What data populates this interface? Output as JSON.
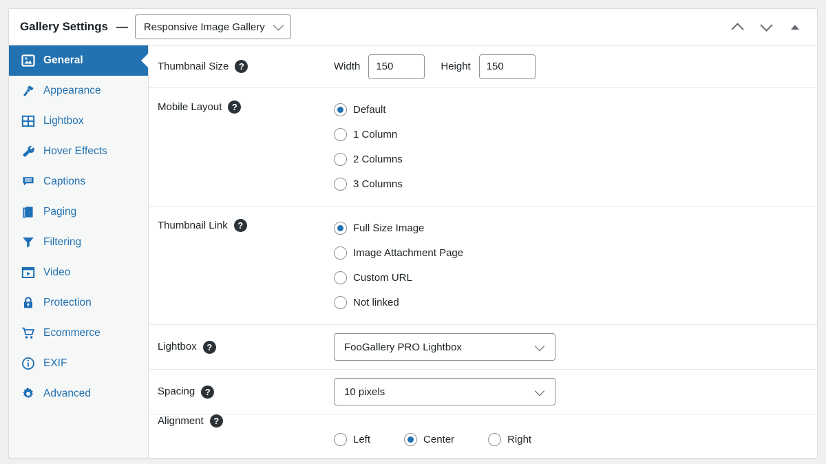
{
  "header": {
    "title": "Gallery Settings",
    "dash": "—",
    "gallery_template": "Responsive Image Gallery",
    "actions": [
      "chevron-up",
      "chevron-down",
      "triangle-up"
    ]
  },
  "sidebar": {
    "items": [
      {
        "label": "General",
        "icon": "image-icon",
        "active": true
      },
      {
        "label": "Appearance",
        "icon": "brush-icon",
        "active": false
      },
      {
        "label": "Lightbox",
        "icon": "grid-icon",
        "active": false
      },
      {
        "label": "Hover Effects",
        "icon": "wrench-icon",
        "active": false
      },
      {
        "label": "Captions",
        "icon": "comment-icon",
        "active": false
      },
      {
        "label": "Paging",
        "icon": "book-icon",
        "active": false
      },
      {
        "label": "Filtering",
        "icon": "funnel-icon",
        "active": false
      },
      {
        "label": "Video",
        "icon": "video-icon",
        "active": false
      },
      {
        "label": "Protection",
        "icon": "lock-icon",
        "active": false
      },
      {
        "label": "Ecommerce",
        "icon": "cart-icon",
        "active": false
      },
      {
        "label": "EXIF",
        "icon": "info-icon",
        "active": false
      },
      {
        "label": "Advanced",
        "icon": "gear-icon",
        "active": false
      }
    ]
  },
  "help_glyph": "?",
  "settings": {
    "thumbnail_size": {
      "label": "Thumbnail Size",
      "width_label": "Width",
      "width_value": "150",
      "height_label": "Height",
      "height_value": "150"
    },
    "mobile_layout": {
      "label": "Mobile Layout",
      "options": [
        {
          "label": "Default",
          "selected": true
        },
        {
          "label": "1 Column",
          "selected": false
        },
        {
          "label": "2 Columns",
          "selected": false
        },
        {
          "label": "3 Columns",
          "selected": false
        }
      ]
    },
    "thumbnail_link": {
      "label": "Thumbnail Link",
      "options": [
        {
          "label": "Full Size Image",
          "selected": true
        },
        {
          "label": "Image Attachment Page",
          "selected": false
        },
        {
          "label": "Custom URL",
          "selected": false
        },
        {
          "label": "Not linked",
          "selected": false
        }
      ]
    },
    "lightbox": {
      "label": "Lightbox",
      "value": "FooGallery PRO Lightbox"
    },
    "spacing": {
      "label": "Spacing",
      "value": "10 pixels"
    },
    "alignment": {
      "label": "Alignment",
      "options": [
        {
          "label": "Left",
          "selected": false
        },
        {
          "label": "Center",
          "selected": true
        },
        {
          "label": "Right",
          "selected": false
        }
      ]
    }
  },
  "colors": {
    "accent": "#2271b1",
    "text": "#1d2327",
    "help_bg": "#2c3338",
    "border": "#dcdcde",
    "sidebar_bg": "#f6f7f7",
    "page_bg": "#f0f0f1"
  }
}
